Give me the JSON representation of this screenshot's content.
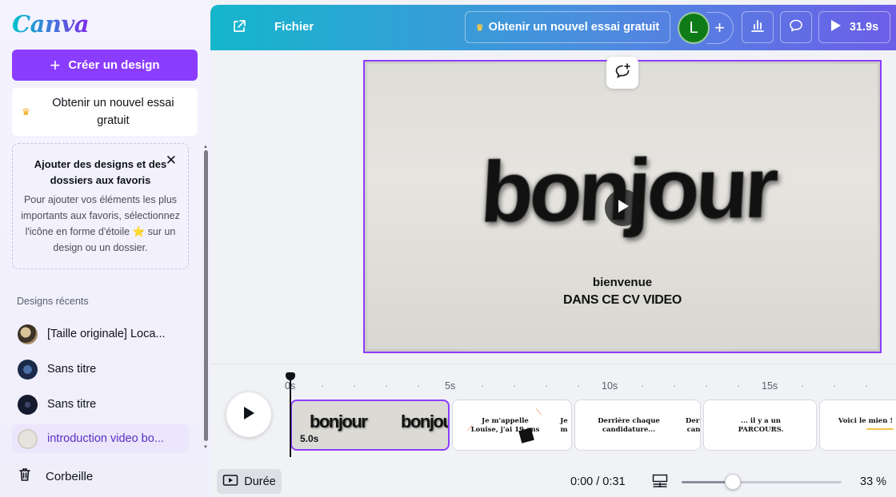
{
  "brand": {
    "logo": "Canva",
    "accent": "#8b3dff"
  },
  "sidebar": {
    "create_label": "Créer un design",
    "trial_label": "Obtenir un nouvel essai gratuit",
    "favorites": {
      "title": "Ajouter des designs et des dossiers aux favoris",
      "description": "Pour ajouter vos éléments les plus importants aux favoris, sélectionnez l'icône en forme d'étoile ⭐ sur un design ou un dossier."
    },
    "recent_label": "Designs récents",
    "recent_items": [
      {
        "label": "[Taille originale] Loca..."
      },
      {
        "label": "Sans titre"
      },
      {
        "label": "Sans titre"
      },
      {
        "label": "introduction video bo..."
      }
    ],
    "trash_label": "Corbeille"
  },
  "topbar": {
    "file_label": "Fichier",
    "trial_label": "Obtenir un nouvel essai gratuit",
    "avatar_initial": "L",
    "avatar_color": "#0f7b17",
    "play_duration": "31.9s"
  },
  "slide": {
    "headline": "bonjour",
    "line1": "bienvenue",
    "line2": "DANS CE CV VIDEO"
  },
  "timeline": {
    "ticks": [
      "0s",
      "5s",
      "10s",
      "15s"
    ],
    "clips": [
      {
        "duration": "5.0s",
        "text": "bonjour"
      },
      {
        "text": "Je m'appelle Louise, j'ai 19 ans",
        "peek": "Je m"
      },
      {
        "text": "Derrière chaque candidature...",
        "peek": "Derr can"
      },
      {
        "text": "... il y a un PARCOURS."
      },
      {
        "text": "Voici le mien ! "
      }
    ],
    "duration_button": "Durée",
    "time": "0:00 / 0:31",
    "zoom_percent": "33 %",
    "zoom_level": 0.33
  }
}
